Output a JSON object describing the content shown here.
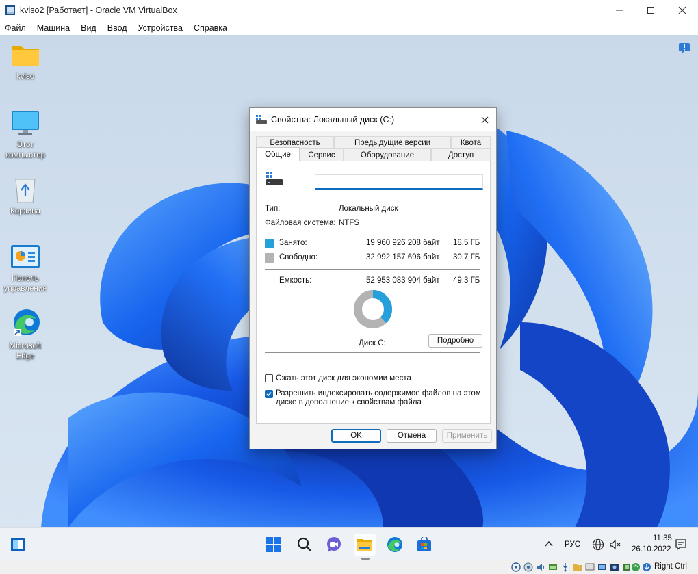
{
  "vbox": {
    "title": "kviso2 [Работает] - Oracle VM VirtualBox",
    "menu": [
      "Файл",
      "Машина",
      "Вид",
      "Ввод",
      "Устройства",
      "Справка"
    ],
    "host_key": "Right Ctrl"
  },
  "desktop_icons": [
    {
      "name": "kviso",
      "icon": "folder-icon"
    },
    {
      "name": "Этот компьютер",
      "icon": "monitor-icon"
    },
    {
      "name": "Корзина",
      "icon": "recycle-bin-icon"
    },
    {
      "name": "Панель управления",
      "icon": "control-panel-icon"
    },
    {
      "name": "Microsoft Edge",
      "icon": "edge-icon"
    }
  ],
  "dialog": {
    "title": "Свойства: Локальный диск (C:)",
    "tabs_back": [
      "Безопасность",
      "Предыдущие версии",
      "Квота"
    ],
    "tabs_front": [
      "Общие",
      "Сервис",
      "Оборудование",
      "Доступ"
    ],
    "active_tab": "Общие",
    "name_value": "",
    "type_label": "Тип:",
    "type_value": "Локальный диск",
    "fs_label": "Файловая система:",
    "fs_value": "NTFS",
    "used_label": "Занято:",
    "used_bytes": "19 960 926 208 байт",
    "used_size": "18,5 ГБ",
    "free_label": "Свободно:",
    "free_bytes": "32 992 157 696 байт",
    "free_size": "30,7 ГБ",
    "capacity_label": "Емкость:",
    "capacity_bytes": "52 953 083 904 байт",
    "capacity_size": "49,3 ГБ",
    "used_fraction": 0.377,
    "used_color": "#26a0da",
    "free_color": "#b3b3b3",
    "disk_label": "Диск C:",
    "details_button": "Подробно",
    "compress_label": "Сжать этот диск для экономии места",
    "compress_checked": false,
    "index_label_1": "Разрешить индексировать содержимое файлов на этом",
    "index_label_2": "диске в дополнение к свойствам файла",
    "index_checked": true,
    "ok_button": "OK",
    "cancel_button": "Отмена",
    "apply_button": "Применить"
  },
  "taskbar": {
    "apps": [
      "widgets-icon",
      "start-icon",
      "search-icon",
      "chat-icon",
      "file-explorer-icon",
      "edge-icon",
      "store-icon"
    ],
    "lang": "РУС",
    "time": "11:35",
    "date": "26.10.2022"
  }
}
